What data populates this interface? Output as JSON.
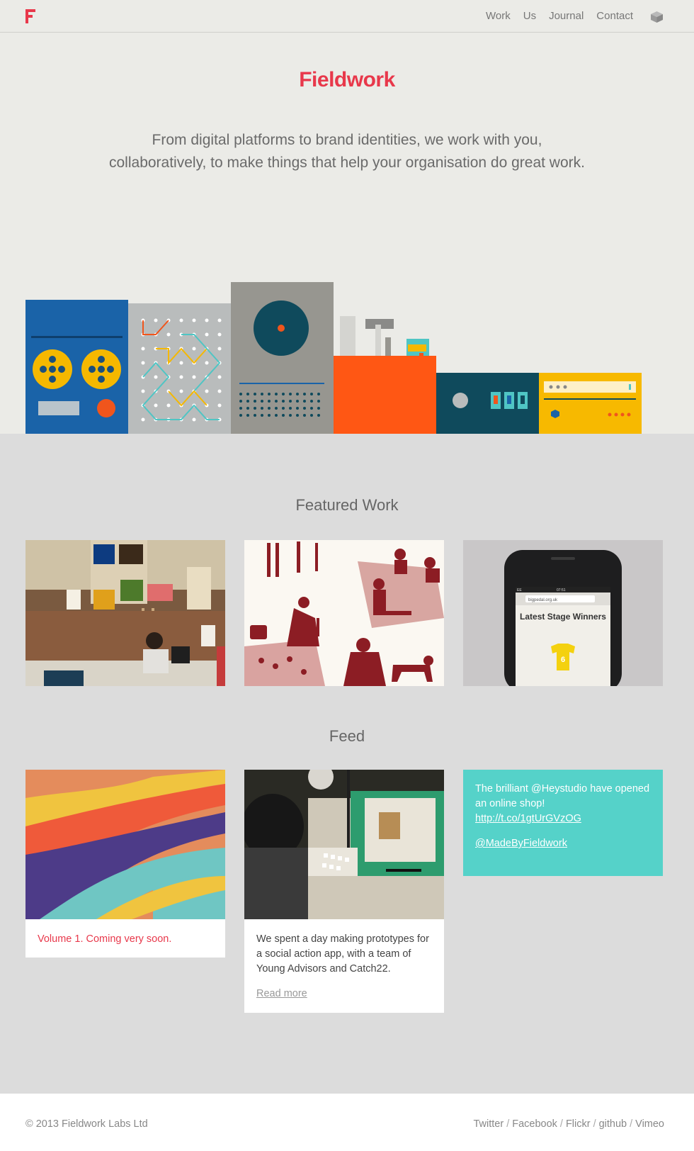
{
  "nav": {
    "links": [
      "Work",
      "Us",
      "Journal",
      "Contact"
    ]
  },
  "hero": {
    "brand": "Fieldwork",
    "intro": "From digital platforms to brand identities, we work with you, collaboratively, to make things that help your organisation do great work."
  },
  "featured": {
    "title": "Featured Work",
    "phone_screen_title": "Latest Stage Winners",
    "phone_url": "bigpedal.org.uk",
    "phone_time": "07:51",
    "phone_carrier": "EE",
    "jersey_number": "6"
  },
  "feed": {
    "title": "Feed",
    "card1_text": "Volume 1. Coming very soon.",
    "card2_text": "We spent a day making prototypes for a social action app, with a team of Young Advisors and Catch22.",
    "card2_link": "Read more",
    "tweet_text": "The brilliant @Heystudio have opened an online shop!",
    "tweet_link": "http://t.co/1gtUrGVzOG",
    "tweet_handle": "@MadeByFieldwork"
  },
  "footer": {
    "copyright": "© 2013 Fieldwork Labs Ltd",
    "social": [
      "Twitter",
      "Facebook",
      "Flickr",
      "github",
      "Vimeo"
    ]
  },
  "colors": {
    "brand_red": "#e8384b",
    "teal": "#55d2c9",
    "hero_bg": "#ebebe7",
    "page_bg": "#dcdcdc"
  },
  "icons": {
    "logo": "fieldwork-f-logo",
    "cube": "cube-icon"
  }
}
